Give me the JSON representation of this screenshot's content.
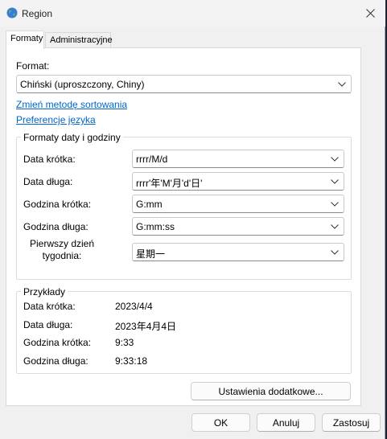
{
  "window": {
    "title": "Region"
  },
  "tabs": [
    {
      "label": "Formaty",
      "active": true
    },
    {
      "label": "Administracyjne",
      "active": false
    }
  ],
  "format": {
    "label": "Format:",
    "selected": "Chiński (uproszczony, Chiny)",
    "link_sort": "Zmień metodę sortowania",
    "link_lang": "Preferencje języka"
  },
  "date_formats": {
    "group_title": "Formaty daty i godziny",
    "rows": [
      {
        "label": "Data krótka:",
        "value": "rrrr/M/d"
      },
      {
        "label": "Data długa:",
        "value": "rrrr'年'M'月'd'日'"
      },
      {
        "label": "Godzina krótka:",
        "value": "G:mm"
      },
      {
        "label": "Godzina długa:",
        "value": "G:mm:ss"
      },
      {
        "label": "Pierwszy dzień tygodnia:",
        "value": "星期一"
      }
    ]
  },
  "examples": {
    "group_title": "Przykłady",
    "rows": [
      {
        "label": "Data krótka:",
        "value": "2023/4/4"
      },
      {
        "label": "Data długa:",
        "value": "2023年4月4日"
      },
      {
        "label": "Godzina krótka:",
        "value": "9:33"
      },
      {
        "label": "Godzina długa:",
        "value": "9:33:18"
      }
    ]
  },
  "buttons": {
    "additional": "Ustawienia dodatkowe...",
    "ok": "OK",
    "cancel": "Anuluj",
    "apply": "Zastosuj"
  },
  "colors": {
    "link": "#0066cc",
    "panel": "#ffffff",
    "dialog": "#f0f0f0"
  }
}
